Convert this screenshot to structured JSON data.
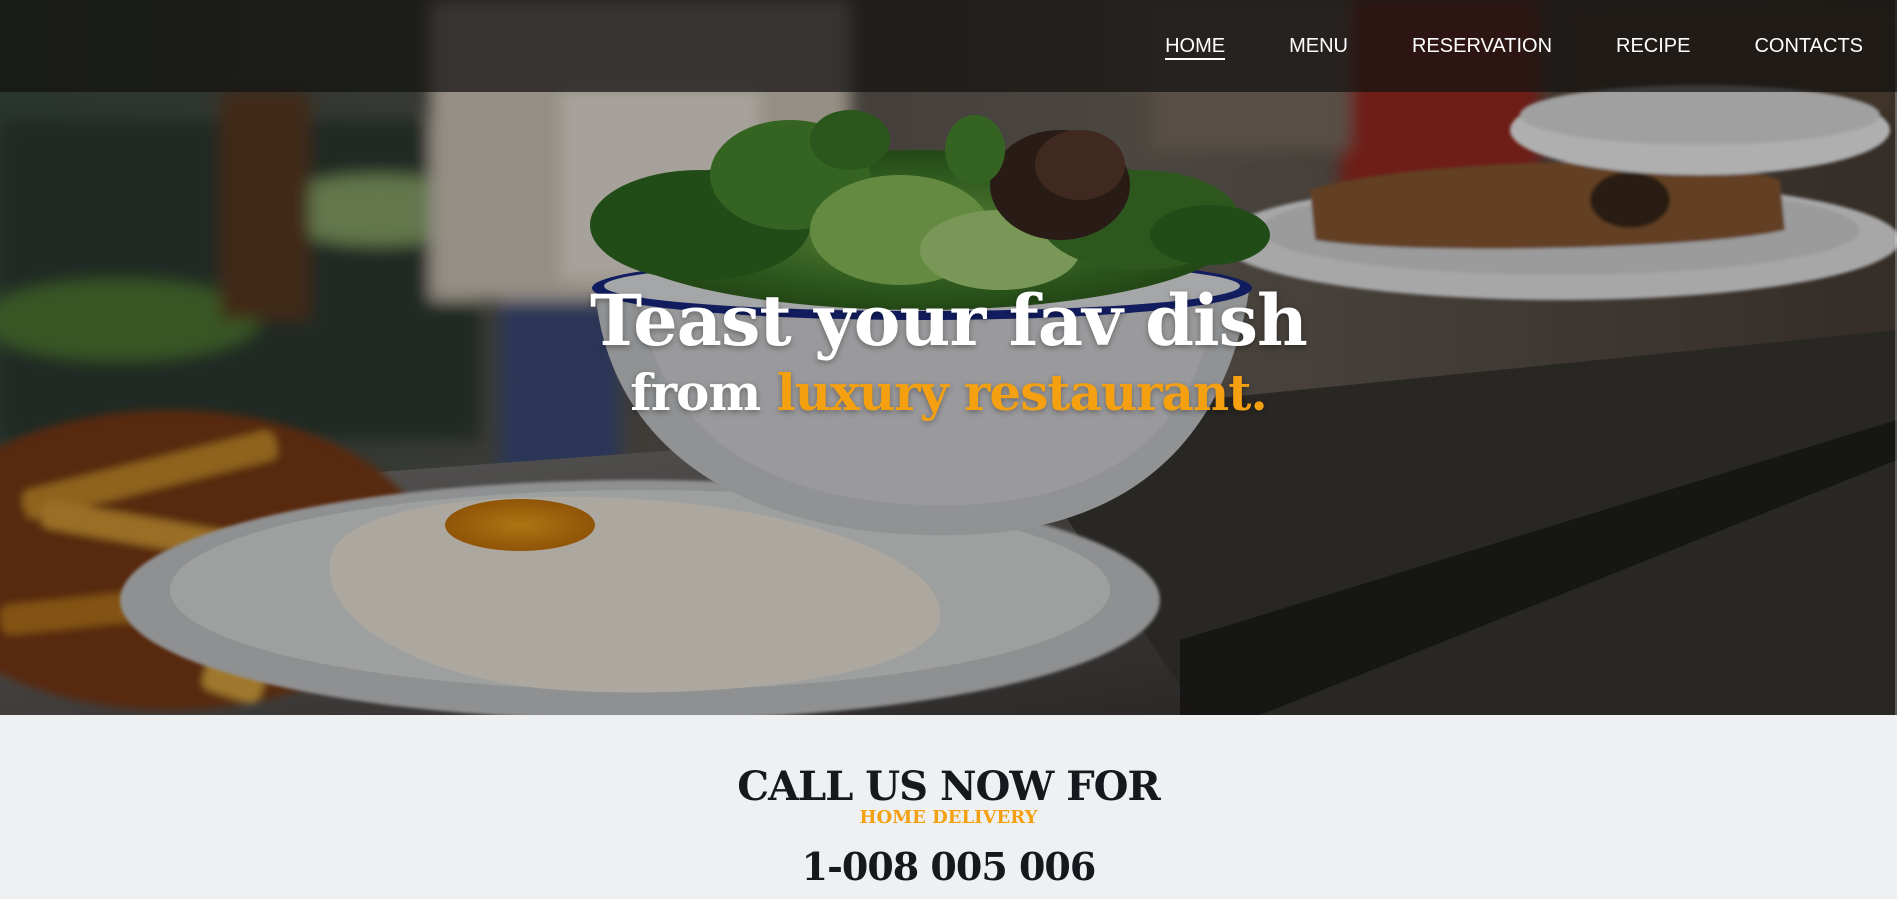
{
  "nav": {
    "items": [
      {
        "label": "HOME",
        "active": true
      },
      {
        "label": "MENU",
        "active": false
      },
      {
        "label": "RESERVATION",
        "active": false
      },
      {
        "label": "RECIPE",
        "active": false
      },
      {
        "label": "CONTACTS",
        "active": false
      }
    ]
  },
  "hero": {
    "line1": "Teast your fav dish",
    "line2_prefix": "from",
    "line2_accent": "luxury restaurant."
  },
  "call": {
    "title": "CALL US NOW FOR",
    "subtitle": "HOME DELIVERY",
    "phone": "1-008 005 006"
  },
  "colors": {
    "accent": "#f5a011",
    "dark_text": "#15181c",
    "section_bg": "#eef0f2",
    "nav_bg": "rgba(20,18,16,0.72)"
  }
}
